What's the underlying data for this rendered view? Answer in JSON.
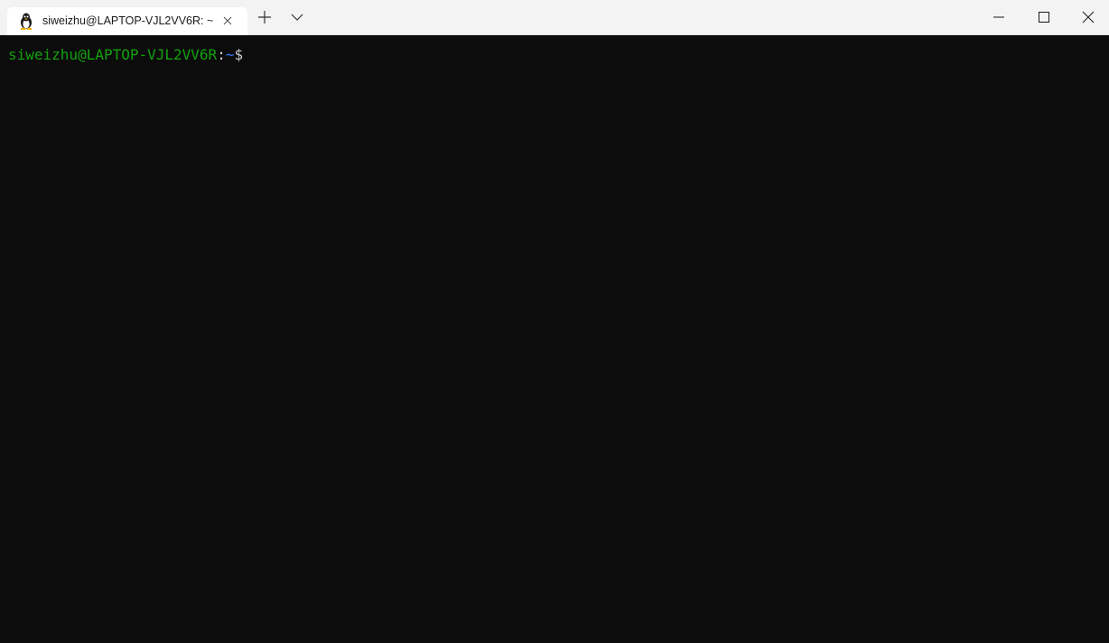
{
  "tab": {
    "title": "siweizhu@LAPTOP-VJL2VV6R: ~",
    "icon": "linux-penguin-icon"
  },
  "toolbar": {
    "new_tab_icon": "plus-icon",
    "dropdown_icon": "chevron-down-icon"
  },
  "window_controls": {
    "minimize_icon": "minimize-icon",
    "maximize_icon": "maximize-icon",
    "close_icon": "close-icon"
  },
  "terminal": {
    "prompt_user_host": "siweizhu@LAPTOP-VJL2VV6R",
    "prompt_colon": ":",
    "prompt_path": "~",
    "prompt_symbol": "$",
    "colors": {
      "background": "#0c0c0c",
      "user_host": "#13a10e",
      "path": "#3b78ff",
      "default_text": "#cccccc"
    }
  }
}
